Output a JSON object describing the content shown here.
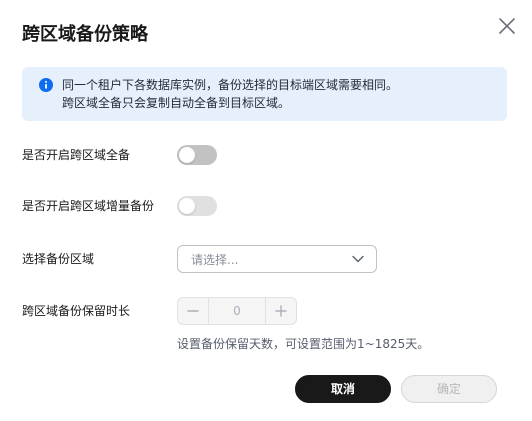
{
  "dialog": {
    "title": "跨区域备份策略",
    "close_icon": "close-icon"
  },
  "notice": {
    "icon": "info-icon",
    "accent_color": "#0c6cf2",
    "background_color": "#e6f0fd",
    "line1": "同一个租户下各数据库实例，备份选择的目标端区域需要相同。",
    "line2": "跨区域全备只会复制自动全备到目标区域。"
  },
  "form": {
    "full_backup": {
      "label": "是否开启跨区域全备",
      "enabled": false
    },
    "incremental_backup": {
      "label": "是否开启跨区域增量备份",
      "enabled": false,
      "disabled": true
    },
    "region": {
      "label": "选择备份区域",
      "placeholder": "请选择...",
      "icon": "chevron-down-icon"
    },
    "retention": {
      "label": "跨区域备份保留时长",
      "value": "0",
      "hint": "设置备份保留天数，可设置范围为1~1825天。",
      "minus_icon": "minus-icon",
      "plus_icon": "plus-icon"
    }
  },
  "footer": {
    "cancel_label": "取消",
    "confirm_label": "确定",
    "cancel_color": "#191919"
  }
}
